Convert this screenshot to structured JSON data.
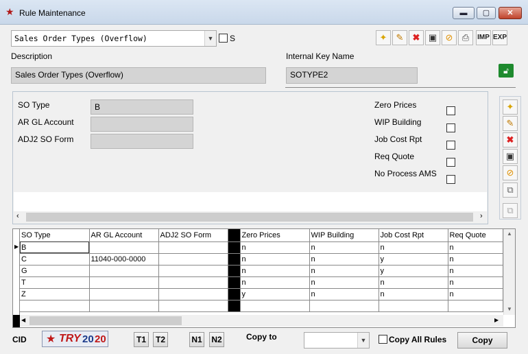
{
  "window": {
    "title": "Rule Maintenance",
    "minimize": "▬",
    "maximize": "▢",
    "close": "✕"
  },
  "rule_select": {
    "value": "Sales Order Types (Overflow)"
  },
  "s_label": "S",
  "toolbar": {
    "imp": "IMP",
    "exp": "EXP"
  },
  "description": {
    "label": "Description",
    "value": "Sales Order Types (Overflow)"
  },
  "internal_key": {
    "label": "Internal Key Name",
    "value": "SOTYPE2"
  },
  "form": {
    "so_type": {
      "label": "SO Type",
      "value": "B"
    },
    "ar_gl": {
      "label": "AR GL Account",
      "value": ""
    },
    "adj2": {
      "label": "ADJ2 SO Form",
      "value": ""
    },
    "zero_prices": "Zero Prices",
    "wip_building": "WIP Building",
    "job_cost_rpt": "Job Cost Rpt",
    "req_quote": "Req Quote",
    "no_process_ams": "No Process AMS"
  },
  "grid": {
    "columns": [
      "SO Type",
      "AR GL Account",
      "ADJ2 SO Form",
      "Zero Prices",
      "WIP Building",
      "Job Cost Rpt",
      "Req Quote"
    ],
    "rows": [
      [
        "B",
        "",
        "",
        "n",
        "n",
        "n",
        "n"
      ],
      [
        "C",
        "11040-000-0000",
        "",
        "n",
        "n",
        "y",
        "n"
      ],
      [
        "G",
        "",
        "",
        "n",
        "n",
        "y",
        "n"
      ],
      [
        "T",
        "",
        "",
        "n",
        "n",
        "n",
        "n"
      ],
      [
        "Z",
        "",
        "",
        "y",
        "n",
        "n",
        "n"
      ]
    ]
  },
  "footer": {
    "cid_label": "CID",
    "logo_text": "TRY",
    "logo_year_a": "20",
    "logo_year_b": "20",
    "t1": "T1",
    "t2": "T2",
    "n1": "N1",
    "n2": "N2",
    "copy_to_label": "Copy to",
    "copy_to_value": "",
    "copy_all_rules": "Copy All Rules",
    "copy_button": "Copy"
  }
}
